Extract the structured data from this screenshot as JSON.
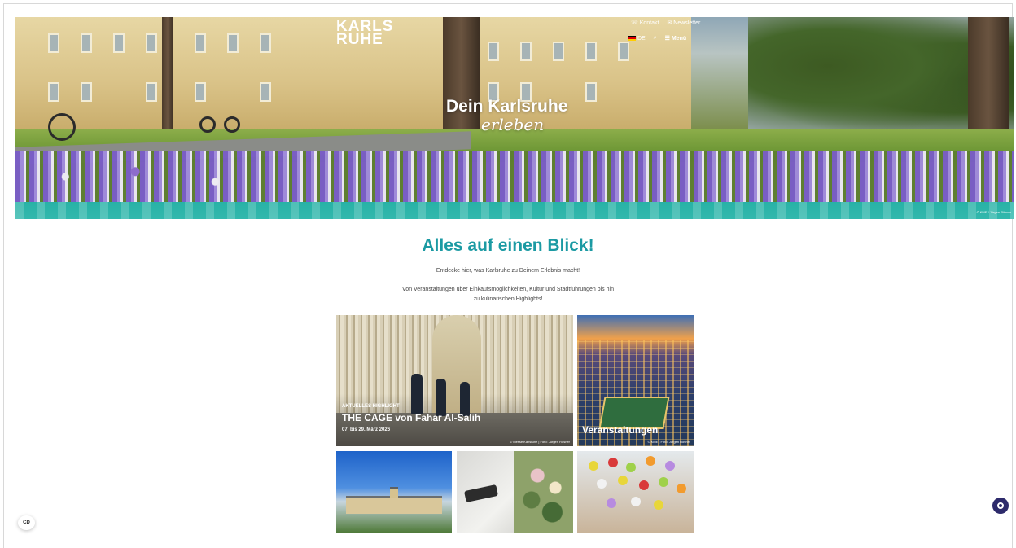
{
  "header": {
    "logo_line1": "KARLS",
    "logo_line2": "RUHE",
    "nav": {
      "kontakt": "Kontakt",
      "newsletter": "Newsletter",
      "language": "DE",
      "menu": "Menü"
    }
  },
  "hero": {
    "title": "Dein Karlsruhe",
    "subtitle": "erleben",
    "credit": "© KME / Jürgen Rösner"
  },
  "section": {
    "title": "Alles auf einen Blick!",
    "intro1": "Entdecke hier, was Karlsruhe zu Deinem Erlebnis macht!",
    "intro2a": "Von Veranstaltungen über Einkaufsmöglichkeiten, Kultur und Stadtführungen bis hin",
    "intro2b": "zu kulinarischen Highlights!"
  },
  "tiles": {
    "cage": {
      "eyebrow": "AKTUELLES HIGHLIGHT",
      "title": "THE CAGE von Fahar Al-Salih",
      "date": "07. bis 29. März 2026",
      "credit": "© Messe Karlsruhe | Foto: Jürgen Rösner"
    },
    "events": {
      "label": "Veranstaltungen",
      "credit": "© KME | Foto: Jürgen Rösner"
    }
  },
  "widgets": {
    "cookie_label": "CD"
  },
  "colors": {
    "accent": "#1b9aa3",
    "hero_band": "#2eb5aa",
    "chat_button": "#2d2a6b"
  },
  "icons": {
    "kontakt": "phone-icon",
    "newsletter": "envelope-icon",
    "search": "search-icon",
    "menu": "hamburger-icon",
    "language": "flag-de-icon",
    "chat": "chat-icon"
  }
}
